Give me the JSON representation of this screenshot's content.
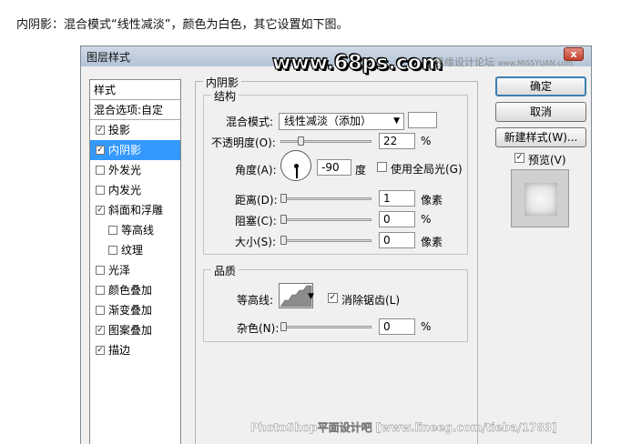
{
  "intro_text": "内阴影：混合模式“线性减淡”，颜色为白色，其它设置如下图。",
  "dialog": {
    "title": "图层样式",
    "close_glyph": "x",
    "watermark_site": "www.68ps.com",
    "watermark_forum": "思缘设计论坛",
    "watermark_forum_url": "www.MISSYUAN.com",
    "watermark_bottom": "PhotoShop平面设计吧 [www.lineeg.com/tieba/1783]"
  },
  "styles_panel": {
    "header": "样式",
    "blend_options": "混合选项:自定",
    "items": [
      {
        "label": "投影",
        "checked": true,
        "selected": false,
        "sub": false
      },
      {
        "label": "内阴影",
        "checked": true,
        "selected": true,
        "sub": false
      },
      {
        "label": "外发光",
        "checked": false,
        "selected": false,
        "sub": false
      },
      {
        "label": "内发光",
        "checked": false,
        "selected": false,
        "sub": false
      },
      {
        "label": "斜面和浮雕",
        "checked": true,
        "selected": false,
        "sub": false
      },
      {
        "label": "等高线",
        "checked": false,
        "selected": false,
        "sub": true
      },
      {
        "label": "纹理",
        "checked": false,
        "selected": false,
        "sub": true
      },
      {
        "label": "光泽",
        "checked": false,
        "selected": false,
        "sub": false
      },
      {
        "label": "颜色叠加",
        "checked": false,
        "selected": false,
        "sub": false
      },
      {
        "label": "渐变叠加",
        "checked": false,
        "selected": false,
        "sub": false
      },
      {
        "label": "图案叠加",
        "checked": true,
        "selected": false,
        "sub": false
      },
      {
        "label": "描边",
        "checked": true,
        "selected": false,
        "sub": false
      }
    ],
    "check_mark": "✓"
  },
  "inner_shadow": {
    "title": "内阴影",
    "structure": {
      "title": "结构",
      "blend_mode_label": "混合模式:",
      "blend_mode_value": "线性减淡（添加）",
      "color": "#ffffff",
      "opacity_label": "不透明度(O):",
      "opacity_value": "22",
      "opacity_unit": "%",
      "opacity_level": 0.22,
      "angle_label": "角度(A):",
      "angle_value": "-90",
      "angle_unit": "度",
      "global_light_label": "使用全局光(G)",
      "global_light_checked": false,
      "distance_label": "距离(D):",
      "distance_value": "1",
      "distance_unit": "像素",
      "choke_label": "阻塞(C):",
      "choke_value": "0",
      "choke_unit": "%",
      "size_label": "大小(S):",
      "size_value": "0",
      "size_unit": "像素"
    },
    "quality": {
      "title": "品质",
      "contour_label": "等高线:",
      "anti_alias_label": "消除锯齿(L)",
      "anti_alias_checked": true,
      "noise_label": "杂色(N):",
      "noise_value": "0",
      "noise_unit": "%"
    }
  },
  "buttons": {
    "ok": "确定",
    "cancel": "取消",
    "new_style": "新建样式(W)...",
    "preview_label": "预览(V)",
    "preview_checked": true
  }
}
